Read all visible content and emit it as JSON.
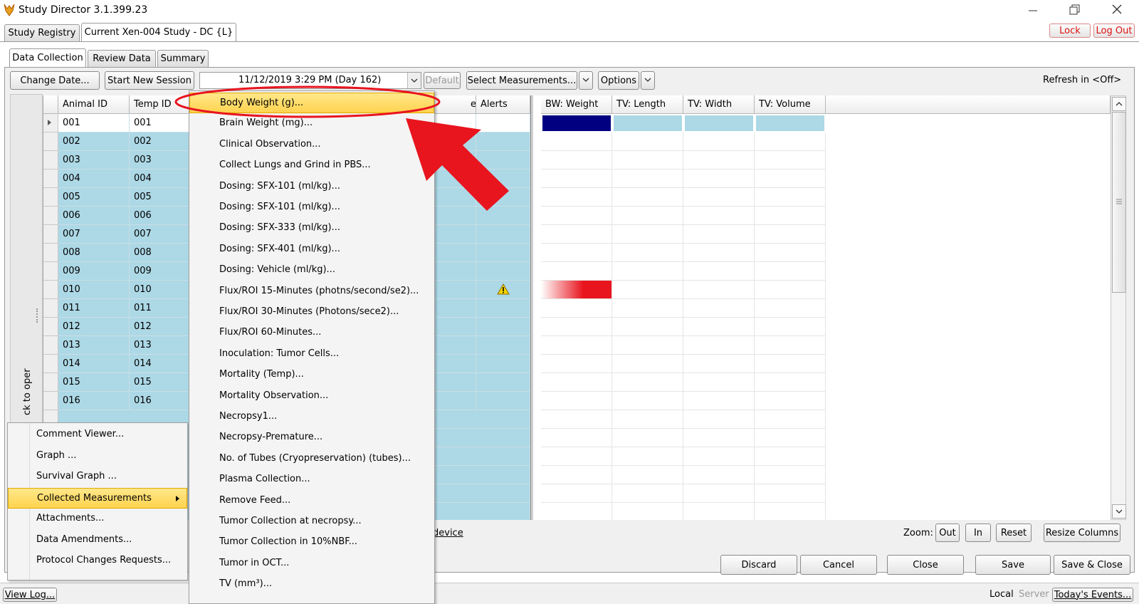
{
  "window": {
    "title": "Study Director 3.1.399.23"
  },
  "top_tabs": [
    {
      "label": "Study Registry"
    },
    {
      "label": "Current Xen-004  Study  - DC {L}"
    }
  ],
  "auth": {
    "lock": "Lock",
    "logout": "Log Out"
  },
  "sub_tabs": [
    {
      "label": "Data Collection"
    },
    {
      "label": "Review Data"
    },
    {
      "label": "Summary"
    }
  ],
  "toolbar": {
    "change_date": "Change Date...",
    "start_session": "Start New Session",
    "date_value": "11/12/2019 3:29 PM (Day 162)",
    "default": "Default",
    "select_measurements": "Select Measurements...",
    "options": "Options",
    "refresh": "Refresh in <Off>"
  },
  "left_grid": {
    "columns": [
      "Animal ID",
      "Temp ID",
      "e",
      "Alerts"
    ],
    "rows": [
      {
        "animal": "001",
        "temp": "001"
      },
      {
        "animal": "002",
        "temp": "002"
      },
      {
        "animal": "003",
        "temp": "003"
      },
      {
        "animal": "004",
        "temp": "004"
      },
      {
        "animal": "005",
        "temp": "005"
      },
      {
        "animal": "006",
        "temp": "006"
      },
      {
        "animal": "007",
        "temp": "007"
      },
      {
        "animal": "008",
        "temp": "008"
      },
      {
        "animal": "009",
        "temp": "009"
      },
      {
        "animal": "010",
        "temp": "010"
      },
      {
        "animal": "011",
        "temp": "011"
      },
      {
        "animal": "012",
        "temp": "012"
      },
      {
        "animal": "013",
        "temp": "013"
      },
      {
        "animal": "014",
        "temp": "014"
      },
      {
        "animal": "015",
        "temp": "015"
      },
      {
        "animal": "016",
        "temp": "016"
      }
    ]
  },
  "right_grid": {
    "columns": [
      "BW: Weight",
      "TV: Length",
      "TV: Width",
      "TV: Volume"
    ]
  },
  "side_panel": {
    "label": "ck to oper"
  },
  "measurements_menu": {
    "items": [
      "Body Weight (g)...",
      "Brain Weight (mg)...",
      "Clinical Observation...",
      "Collect Lungs and Grind in PBS...",
      "Dosing: SFX-101 (ml/kg)...",
      "Dosing: SFX-101 (ml/kg)...",
      "Dosing: SFX-333 (ml/kg)...",
      "Dosing: SFX-401 (ml/kg)...",
      "Dosing: Vehicle (ml/kg)...",
      "Flux/ROI 15-Minutes (photns/second/se2)...",
      "Flux/ROI 30-Minutes (Photons/sece2)...",
      "Flux/ROI 60-Minutes...",
      "Inoculation: Tumor Cells...",
      "Mortality (Temp)...",
      "Mortality Observation...",
      "Necropsy1...",
      "Necropsy-Premature...",
      "No. of Tubes (Cryopreservation) (tubes)...",
      "Plasma Collection...",
      "Remove Feed...",
      "Tumor Collection at necropsy...",
      "Tumor Collection in 10%NBF...",
      "Tumor in OCT...",
      "TV (mm³)..."
    ]
  },
  "context_menu": {
    "items": [
      "Comment Viewer...",
      "Graph ...",
      "Survival Graph ...",
      "Collected Measurements",
      "Attachments...",
      "Data Amendments...",
      "Protocol Changes Requests..."
    ]
  },
  "link_device": "device",
  "zoom": {
    "label": "Zoom:",
    "out": "Out",
    "in": "In",
    "reset": "Reset",
    "resize": "Resize Columns"
  },
  "actions": {
    "discard": "Discard",
    "cancel": "Cancel",
    "close": "Close",
    "save": "Save",
    "save_close": "Save & Close"
  },
  "status": {
    "view_log": "View Log...",
    "local": "Local",
    "server": "Server",
    "events": "Today's Events..."
  },
  "colors": {
    "highlight": "#ffd34f",
    "row_blue": "#add8e6",
    "selected": "#000080",
    "annotation_red": "#e8141e"
  }
}
